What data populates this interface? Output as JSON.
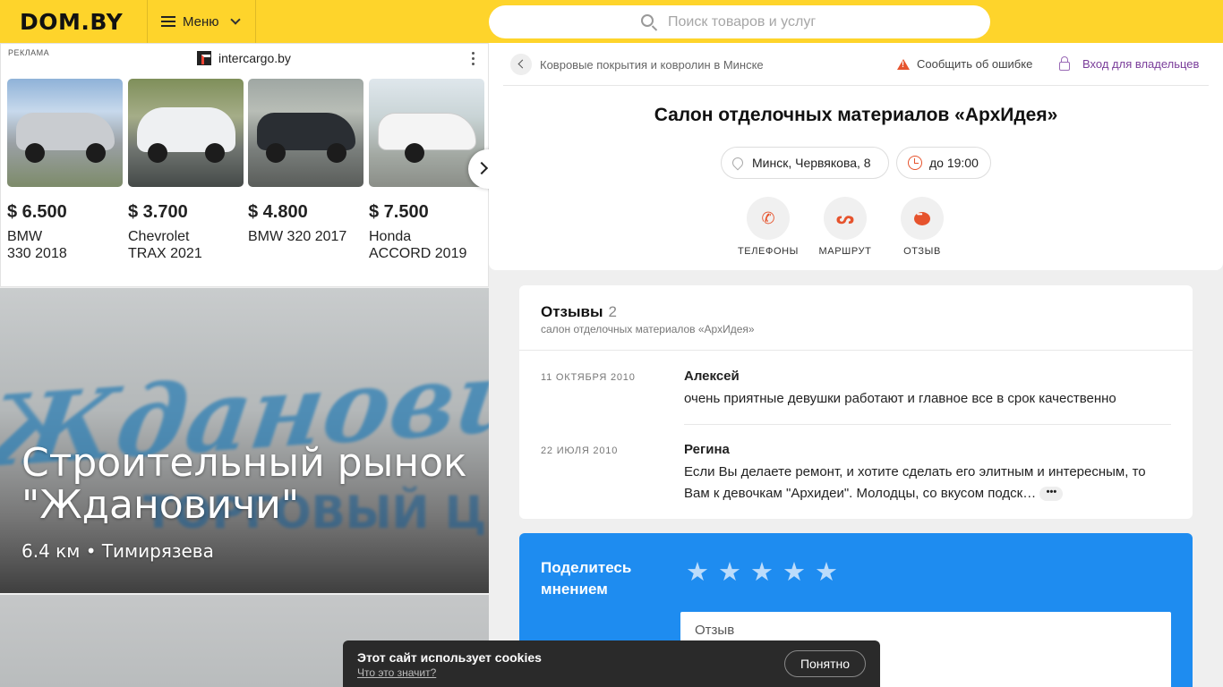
{
  "header": {
    "logo": "DOM.BY",
    "menu_label": "Меню",
    "search_placeholder": "Поиск товаров и услуг"
  },
  "ad": {
    "tag": "РЕКЛАМА",
    "source": "intercargo.by",
    "cars": [
      {
        "price": "$ 6.500",
        "name": "BMW\n330 2018",
        "color": "#c9ccd0"
      },
      {
        "price": "$ 3.700",
        "name": "Chevrolet\nTRAX 2021",
        "color": "#eef0f2"
      },
      {
        "price": "$ 4.800",
        "name": "BMW 320 2017",
        "color": "#2a2e33"
      },
      {
        "price": "$ 7.500",
        "name": "Honda\nACCORD 2019",
        "color": "#f4f4f4"
      }
    ]
  },
  "promo": {
    "title": "Строительный рынок \"Ждановичи\"",
    "meta": "6.4 км • Тимирязева",
    "logo_text": "Ждановичи",
    "logo_sub": "ТОРГОВЫЙ ЦЕНТР"
  },
  "shop": {
    "breadcrumb": "Ковровые покрытия и ковролин в Минске",
    "report": "Сообщить об ошибке",
    "owner": "Вход для владельцев",
    "title": "Салон отделочных материалов «АрхИдея»",
    "address": "Минск, Червякова, 8",
    "hours": "до 19:00",
    "actions": {
      "phones": "ТЕЛЕФОНЫ",
      "route": "МАРШРУТ",
      "review": "ОТЗЫВ"
    }
  },
  "reviews": {
    "heading": "Отзывы",
    "count": "2",
    "subtitle": "салон отделочных материалов «АрхИдея»",
    "items": [
      {
        "date": "11 ОКТЯБРЯ 2010",
        "author": "Алексей",
        "text": "очень приятные девушки работают и главное все в срок качественно"
      },
      {
        "date": "22 ИЮЛЯ 2010",
        "author": "Регина",
        "text": "Если Вы делаете ремонт, и хотите сделать его элитным и интересным, то Вам к девочкам \"Архидеи\". Молодцы, со вкусом подск…"
      }
    ]
  },
  "opinion": {
    "title": "Поделитесь мнением",
    "review_placeholder": "Отзыв"
  },
  "cookie": {
    "title": "Этот сайт использует cookies",
    "link": "Что это значит?",
    "button": "Понятно"
  },
  "colors": {
    "header_bg": "#fed42b",
    "accent_orange": "#e6532d",
    "opinion_blue": "#1e8cf0",
    "owner_link": "#7a3d9a"
  }
}
